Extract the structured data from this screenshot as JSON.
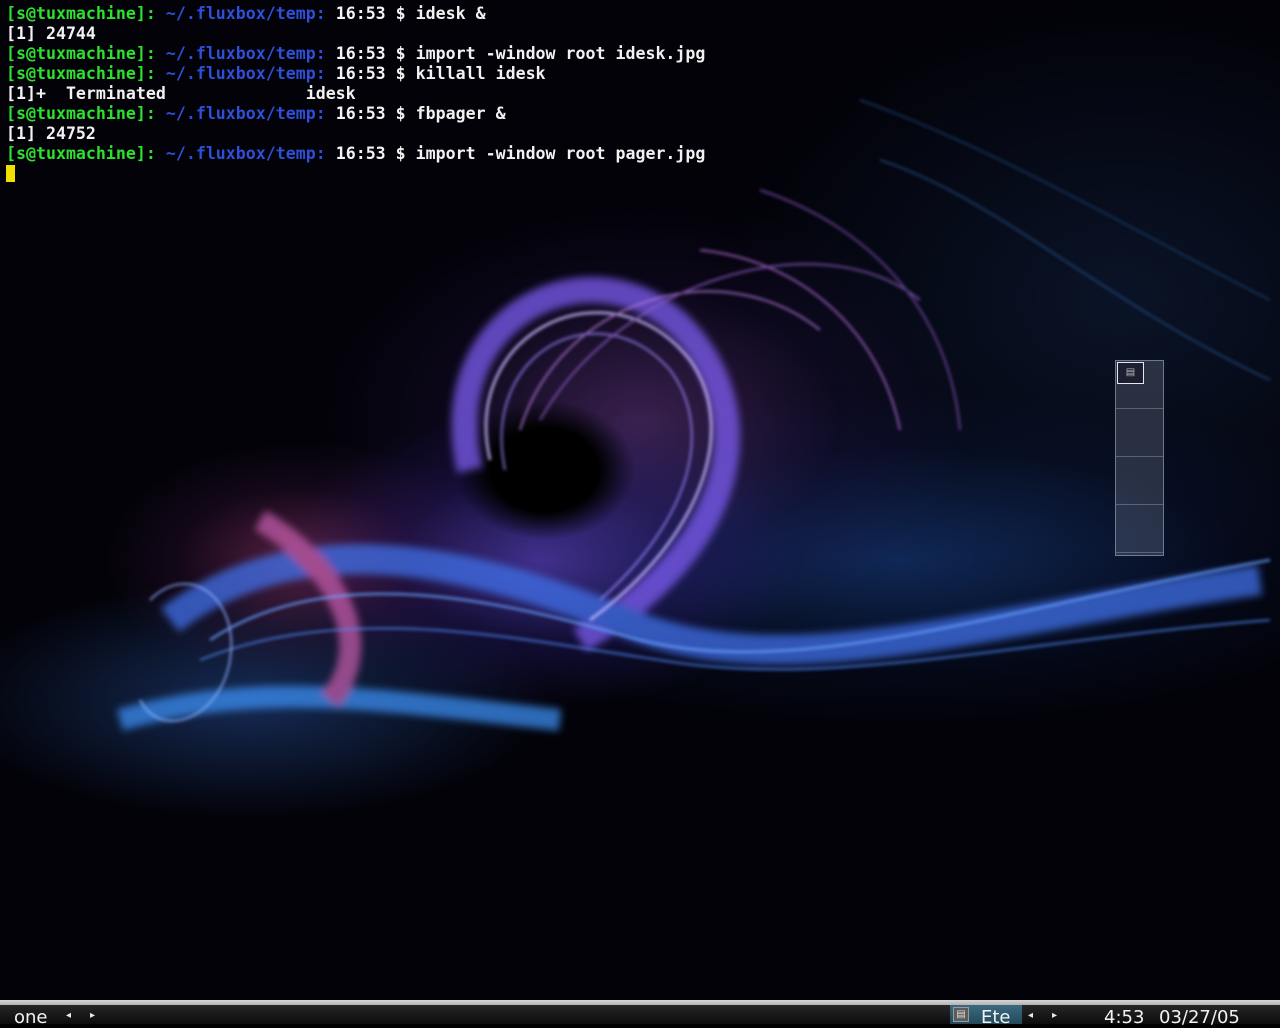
{
  "terminal": {
    "lines": [
      {
        "type": "prompt",
        "user": "[s@tuxmachine]:",
        "path": "~/.fluxbox/temp:",
        "time": "16:53",
        "symbol": "$",
        "cmd": "idesk &"
      },
      {
        "type": "output",
        "text": "[1] 24744"
      },
      {
        "type": "prompt",
        "user": "[s@tuxmachine]:",
        "path": "~/.fluxbox/temp:",
        "time": "16:53",
        "symbol": "$",
        "cmd": "import -window root idesk.jpg"
      },
      {
        "type": "prompt",
        "user": "[s@tuxmachine]:",
        "path": "~/.fluxbox/temp:",
        "time": "16:53",
        "symbol": "$",
        "cmd": "killall idesk"
      },
      {
        "type": "output",
        "text": "[1]+  Terminated              idesk"
      },
      {
        "type": "prompt",
        "user": "[s@tuxmachine]:",
        "path": "~/.fluxbox/temp:",
        "time": "16:53",
        "symbol": "$",
        "cmd": "fbpager &"
      },
      {
        "type": "output",
        "text": "[1] 24752"
      },
      {
        "type": "prompt",
        "user": "[s@tuxmachine]:",
        "path": "~/.fluxbox/temp:",
        "time": "16:53",
        "symbol": "$",
        "cmd": "import -window root pager.jpg"
      }
    ]
  },
  "pager": {
    "workspace_count": 4,
    "active_workspace": 1
  },
  "toolbar": {
    "workspace_name": "one",
    "prev_workspace_glyph": "◂",
    "next_workspace_glyph": "▸",
    "task_label": "Ete",
    "prev_window_glyph": "◂",
    "next_window_glyph": "▸",
    "clock_time": "4:53",
    "clock_date": "03/27/05",
    "task_icon": "terminal-icon"
  },
  "colors": {
    "prompt_user": "#2ee02e",
    "prompt_path": "#2f4fd8",
    "cursor": "#f0e000",
    "taskbutton": "#2f5a6e"
  }
}
